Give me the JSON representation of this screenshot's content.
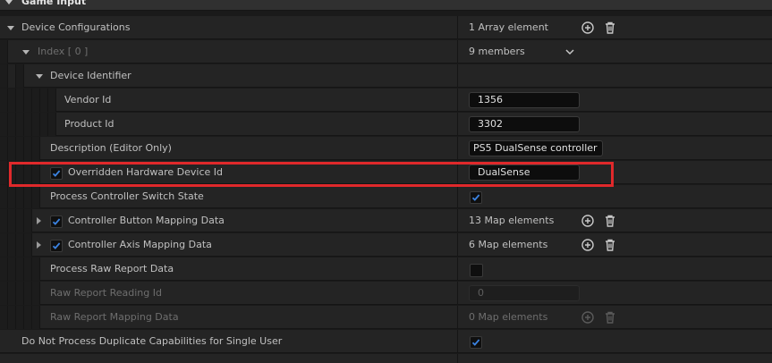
{
  "section": {
    "title": "Game Input"
  },
  "rows": {
    "device_configurations": {
      "label": "Device Configurations",
      "value": "1 Array element"
    },
    "index": {
      "label": "Index [ 0 ]",
      "value": "9 members"
    },
    "device_identifier": {
      "label": "Device Identifier"
    },
    "vendor_id": {
      "label": "Vendor Id",
      "value": "1356"
    },
    "product_id": {
      "label": "Product Id",
      "value": "3302"
    },
    "description": {
      "label": "Description (Editor Only)",
      "value": "PS5 DualSense controller"
    },
    "overridden_id": {
      "label": "Overridden Hardware Device Id",
      "value": "DualSense",
      "checked": true
    },
    "process_switch_state": {
      "label": "Process Controller Switch State",
      "checked": true
    },
    "button_mapping": {
      "label": "Controller Button Mapping Data",
      "value": "13 Map elements",
      "checked": true
    },
    "axis_mapping": {
      "label": "Controller Axis Mapping Data",
      "value": "6 Map elements",
      "checked": true
    },
    "process_raw_report": {
      "label": "Process Raw Report Data",
      "checked": false
    },
    "raw_report_reading_id": {
      "label": "Raw Report Reading Id",
      "value": "0"
    },
    "raw_report_mapping": {
      "label": "Raw Report Mapping Data",
      "value": "0 Map elements"
    },
    "no_duplicate_capabilities": {
      "label": "Do Not Process Duplicate Capabilities for Single User",
      "checked": true
    }
  },
  "icons": {
    "add": "plus-circle-icon",
    "remove": "trash-icon",
    "expand": "chevron-down-icon",
    "check": "checkmark-icon"
  },
  "colors": {
    "accent": "#3b82e0",
    "highlight": "#e0292b",
    "background": "#1a1a1a",
    "row": "#242424"
  }
}
